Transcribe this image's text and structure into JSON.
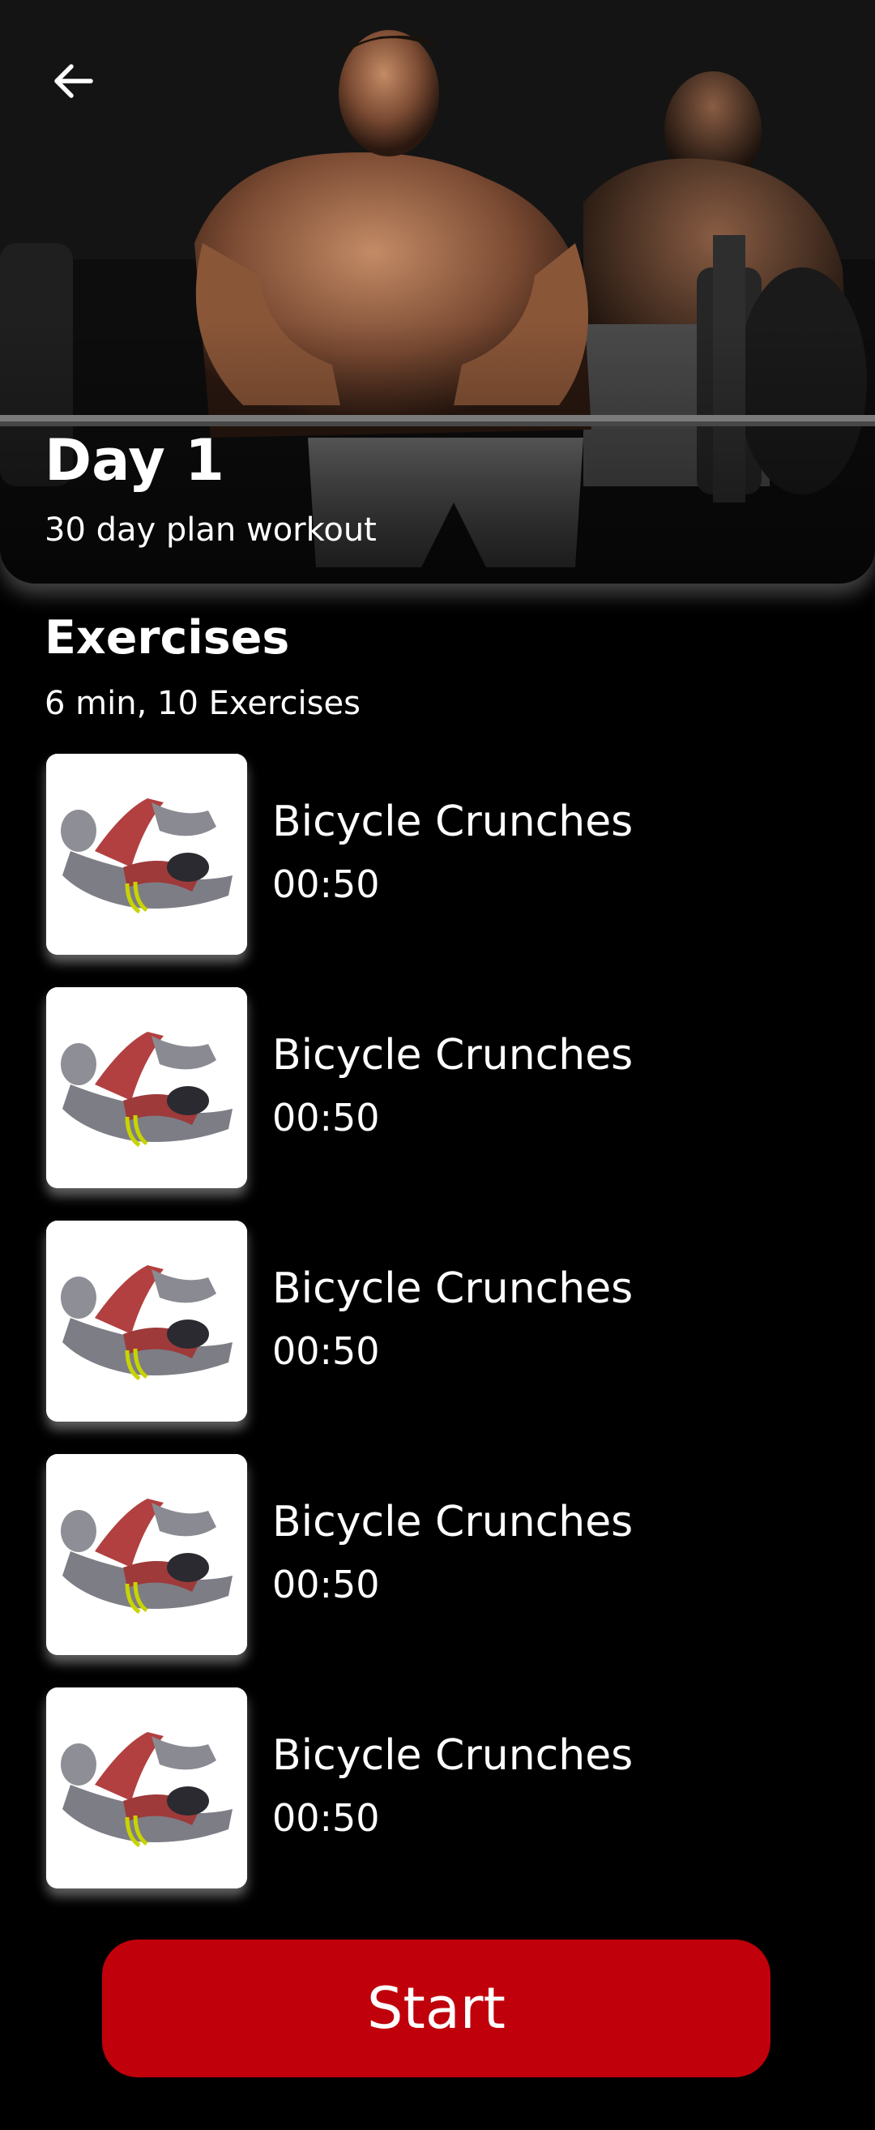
{
  "header": {
    "back_icon": "arrow-left-icon",
    "title": "Day 1",
    "subtitle": "30 day plan workout"
  },
  "exercises_section": {
    "title": "Exercises",
    "summary": "6 min, 10 Exercises",
    "items": [
      {
        "name": "Bicycle Crunches",
        "duration": "00:50"
      },
      {
        "name": "Bicycle Crunches",
        "duration": "00:50"
      },
      {
        "name": "Bicycle Crunches",
        "duration": "00:50"
      },
      {
        "name": "Bicycle Crunches",
        "duration": "00:50"
      },
      {
        "name": "Bicycle Crunches",
        "duration": "00:50"
      }
    ]
  },
  "footer": {
    "start_label": "Start"
  },
  "colors": {
    "background": "#000000",
    "accent": "#c0000b",
    "text": "#ffffff"
  }
}
